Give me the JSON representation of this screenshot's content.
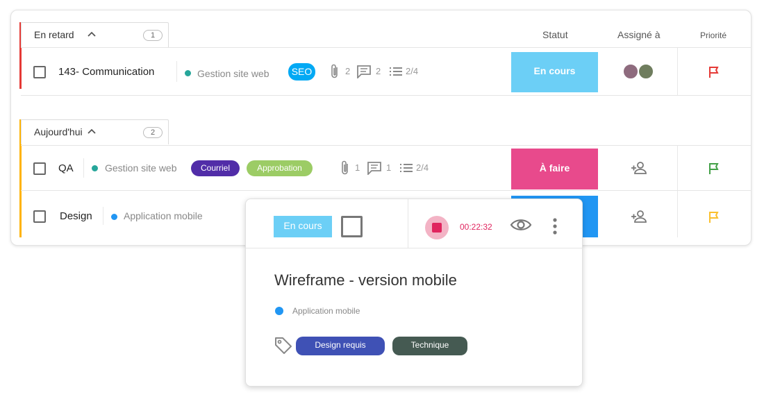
{
  "columns": {
    "status": "Statut",
    "assignee": "Assigné à",
    "priority": "Priorité"
  },
  "groups": [
    {
      "label": "En retard",
      "count": "1",
      "color": "#e53935",
      "tasks": [
        {
          "title": "143- Communication",
          "project": "Gestion site web",
          "project_color": "#26a69a",
          "tags": [
            {
              "label": "SEO",
              "color": "#03a9f4"
            }
          ],
          "attachments": "2",
          "comments": "2",
          "checklist": "2/4",
          "status": "En cours",
          "status_color": "#6ccff6",
          "priority_color": "#e53935"
        }
      ]
    },
    {
      "label": "Aujourd'hui",
      "count": "2",
      "color": "#ffb300",
      "tasks": [
        {
          "title": "QA",
          "project": "Gestion site web",
          "project_color": "#26a69a",
          "tags": [
            {
              "label": "Courriel",
              "color": "#512da8"
            },
            {
              "label": "Approbation",
              "color": "#9ccc65"
            }
          ],
          "attachments": "1",
          "comments": "1",
          "checklist": "2/4",
          "status": "À faire",
          "status_color": "#e84a8c",
          "priority_color": "#43a047"
        },
        {
          "title": "Design",
          "project": "Application mobile",
          "project_color": "#2196f3",
          "status_color": "#2196f3",
          "priority_color": "#fbc02d"
        }
      ]
    }
  ],
  "popup": {
    "status": "En cours",
    "timer": "00:22:32",
    "title": "Wireframe - version mobile",
    "project": "Application mobile",
    "tags": [
      {
        "label": "Design requis",
        "color": "#3f51b5"
      },
      {
        "label": "Technique",
        "color": "#455a52"
      }
    ]
  }
}
